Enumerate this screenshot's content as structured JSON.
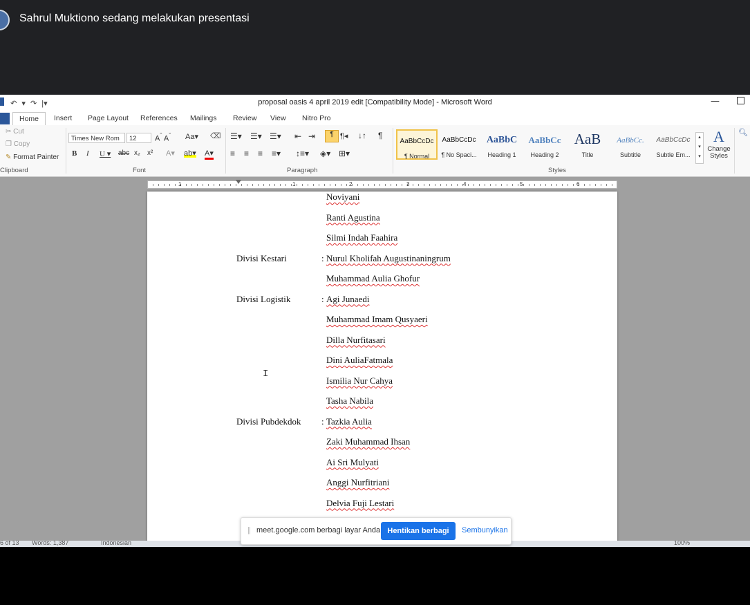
{
  "meet": {
    "presenter_text": "Sahrul Muktiono sedang melakukan presentasi"
  },
  "window": {
    "title": "proposal oasis 4 april 2019 edit [Compatibility Mode]  -  Microsoft Word",
    "qat": [
      "↶",
      "▾",
      "↷",
      "|▾"
    ],
    "minimize": "—"
  },
  "tabs": [
    "Home",
    "Insert",
    "Page Layout",
    "References",
    "Mailings",
    "Review",
    "View",
    "Nitro Pro"
  ],
  "ribbon": {
    "clipboard": {
      "cut": "Cut",
      "copy": "Copy",
      "format_painter": "Format Painter",
      "label": "Clipboard"
    },
    "font": {
      "face": "Times New Rom",
      "size": "12",
      "label": "Font"
    },
    "paragraph": {
      "label": "Paragraph"
    },
    "styles": {
      "label": "Styles",
      "items": [
        {
          "sample": "AaBbCcDc",
          "name": "¶ Normal"
        },
        {
          "sample": "AaBbCcDc",
          "name": "¶ No Spaci..."
        },
        {
          "sample": "AaBbC",
          "name": "Heading 1"
        },
        {
          "sample": "AaBbCc",
          "name": "Heading 2"
        },
        {
          "sample": "AaB",
          "name": "Title"
        },
        {
          "sample": "AaBbCc.",
          "name": "Subtitle"
        },
        {
          "sample": "AaBbCcDc",
          "name": "Subtle Em..."
        }
      ],
      "change_styles": "Change Styles"
    }
  },
  "ruler": {
    "numbers": [
      "1",
      "1",
      "2",
      "3",
      "4",
      "5",
      "6"
    ]
  },
  "document": {
    "lines": [
      {
        "label": "",
        "colon": "",
        "name": "Noviyani"
      },
      {
        "label": "",
        "colon": "",
        "name": "Ranti Agustina"
      },
      {
        "label": "",
        "colon": "",
        "name": "Silmi Indah Faahira"
      },
      {
        "label": "Divisi Kestari",
        "colon": ":",
        "name": "Nurul Kholifah Augustinaningrum"
      },
      {
        "label": "",
        "colon": "",
        "name": "Muhammad Aulia Ghofur"
      },
      {
        "label": "Divisi Logistik",
        "colon": ":",
        "name": "Agi Junaedi"
      },
      {
        "label": "",
        "colon": "",
        "name": "Muhammad Imam Qusyaeri"
      },
      {
        "label": "",
        "colon": "",
        "name": "Dilla Nurfitasari"
      },
      {
        "label": "",
        "colon": "",
        "name": "Dini AuliaFatmala"
      },
      {
        "label": "",
        "colon": "",
        "name": "Ismilia Nur Cahya"
      },
      {
        "label": "",
        "colon": "",
        "name": "Tasha Nabila"
      },
      {
        "label": "Divisi Pubdekdok",
        "colon": ":",
        "name": "Tazkia Aulia"
      },
      {
        "label": "",
        "colon": "",
        "name": "Zaki Muhammad Ihsan"
      },
      {
        "label": "",
        "colon": "",
        "name": "Ai Sri Mulyati"
      },
      {
        "label": "",
        "colon": "",
        "name": "Anggi Nurfitriani"
      },
      {
        "label": "",
        "colon": "",
        "name": "Delvia Fuji Lestari"
      }
    ]
  },
  "share_banner": {
    "text": "meet.google.com berbagi layar Anda.",
    "stop_button": "Hentikan berbagi",
    "hide_link": "Sembunyikan"
  },
  "status": {
    "page": "6 of 13",
    "words": "Words: 1,387",
    "language": "Indonesian",
    "zoom": "100%"
  },
  "colors": {
    "meet_bg": "#202124",
    "meet_button": "#1a73e8",
    "word_accent": "#2b579a"
  }
}
